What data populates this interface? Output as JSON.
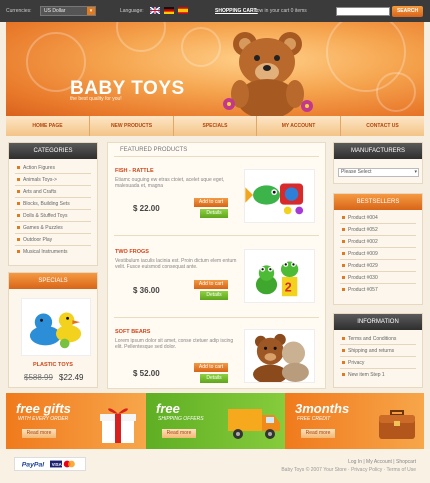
{
  "topbar": {
    "currencies_label": "Currencies:",
    "currency_value": "US Dollar",
    "language_label": "Language:",
    "cart_link": "SHOPPING CART:",
    "cart_text": "now in your cart 0 items",
    "search_button": "SEARCH"
  },
  "header": {
    "title": "BABY TOYS",
    "subtitle": "the best quality for you!"
  },
  "nav": [
    "HOME PAGE",
    "NEW PRODUCTS",
    "SPECIALS",
    "MY ACCOUNT",
    "CONTACT US"
  ],
  "categories": {
    "title": "CATEGORIES",
    "items": [
      "Action Figures",
      "Animals Toys->",
      "Arts and Crafts",
      "Blocks, Building Sets",
      "Dolls & Stuffed Toys",
      "Games & Puzzles",
      "Outdoor Play",
      "Musical Instruments"
    ]
  },
  "specials": {
    "title": "SPECIALS",
    "product_name": "PLASTIC TOYS",
    "old_price": "$588.99",
    "new_price": "$22.49"
  },
  "featured": {
    "title": "FEATURED PRODUCTS",
    "products": [
      {
        "name": "FISH - RATTLE",
        "desc": "Etiamc ouguing ew etras ctoiet, acelet uque eget, malesuada et, magna",
        "price": "$ 22.00",
        "cart": "Add to cart",
        "details": "Details"
      },
      {
        "name": "TWO FROGS",
        "desc": "Vestibulum iaculis lacinia est. Proin dictum elem entum velit. Fusce euismod consequat ante.",
        "price": "$ 36.00",
        "cart": "Add to cart",
        "details": "Details"
      },
      {
        "name": "SOFT BEARS",
        "desc": "Lorem ipsum dolor sit amet, conse ctetuer adip iscing elit. Pellentesque sed dolor.",
        "price": "$ 52.00",
        "cart": "Add to cart",
        "details": "Details"
      }
    ]
  },
  "manufacturers": {
    "title": "MANUFACTURERS",
    "select_value": "Please Select"
  },
  "bestsellers": {
    "title": "BESTSELLERS",
    "items": [
      "Product #004",
      "Product #052",
      "Product #002",
      "Product #009",
      "Product #029",
      "Product #030",
      "Product #057"
    ]
  },
  "information": {
    "title": "INFORMATION",
    "items": [
      "Terms and Conditions",
      "Shipping and returns",
      "Privacy",
      "New item Step 1"
    ]
  },
  "promos": [
    {
      "title": "free gifts",
      "sub": "WITH EVERY ORDER",
      "button": "Read more"
    },
    {
      "title": "free",
      "sub": "SHIPPING OFFERS",
      "button": "Read more"
    },
    {
      "title": "3months",
      "sub": "FREE CREDIT",
      "button": "Read more"
    }
  ],
  "footer": {
    "links": "Log In  |  My Account  |  Shopcart",
    "copyright": "Baby Toys © 2007 Your Store  ·  Privacy Policy  ·  Terms of Use"
  },
  "colors": {
    "accent": "#e07a1f",
    "dark": "#3b3b3b",
    "green": "#6fb52a",
    "price": "#d0451b"
  }
}
